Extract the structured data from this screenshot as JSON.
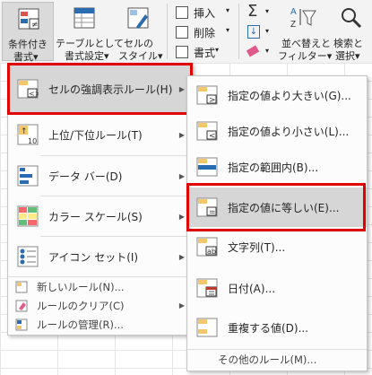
{
  "ribbon": {
    "conditional_format": [
      "条件付き",
      "書式▾"
    ],
    "format_as_table": [
      "テーブルとして",
      "書式設定▾"
    ],
    "cell_styles": [
      "セルの",
      "スタイル▾"
    ],
    "insert": "挿入",
    "delete": "削除",
    "format": "書式",
    "sort_filter": [
      "並べ替えと",
      "フィルター▾"
    ],
    "find_select": [
      "検索と",
      "選択▾"
    ]
  },
  "menu1": {
    "items": [
      {
        "label": "セルの強調表示ルール(H)",
        "icon": "highlight-cells-icon",
        "submenu": true
      },
      {
        "label": "上位/下位ルール(T)",
        "icon": "top-bottom-icon",
        "submenu": true
      },
      {
        "label": "データ バー(D)",
        "icon": "data-bar-icon",
        "submenu": true
      },
      {
        "label": "カラー スケール(S)",
        "icon": "color-scale-icon",
        "submenu": true
      },
      {
        "label": "アイコン セット(I)",
        "icon": "icon-set-icon",
        "submenu": true
      }
    ],
    "small_items": [
      {
        "label": "新しいルール(N)...",
        "icon": "new-rule-icon"
      },
      {
        "label": "ルールのクリア(C)",
        "icon": "clear-rules-icon",
        "submenu": true
      },
      {
        "label": "ルールの管理(R)...",
        "icon": "manage-rules-icon"
      }
    ]
  },
  "menu2": {
    "items": [
      {
        "label": "指定の値より大きい(G)...",
        "icon": "greater-than-icon"
      },
      {
        "label": "指定の値より小さい(L)...",
        "icon": "less-than-icon"
      },
      {
        "label": "指定の範囲内(B)...",
        "icon": "between-icon"
      },
      {
        "label": "指定の値に等しい(E)...",
        "icon": "equal-to-icon"
      },
      {
        "label": "文字列(T)...",
        "icon": "text-contains-icon"
      },
      {
        "label": "日付(A)...",
        "icon": "date-occurring-icon"
      },
      {
        "label": "重複する値(D)...",
        "icon": "duplicate-values-icon"
      }
    ],
    "more_rules": "その他のルール(M)..."
  },
  "colors": {
    "highlight_border": "#e00000",
    "hover": "#d6d6d6"
  }
}
